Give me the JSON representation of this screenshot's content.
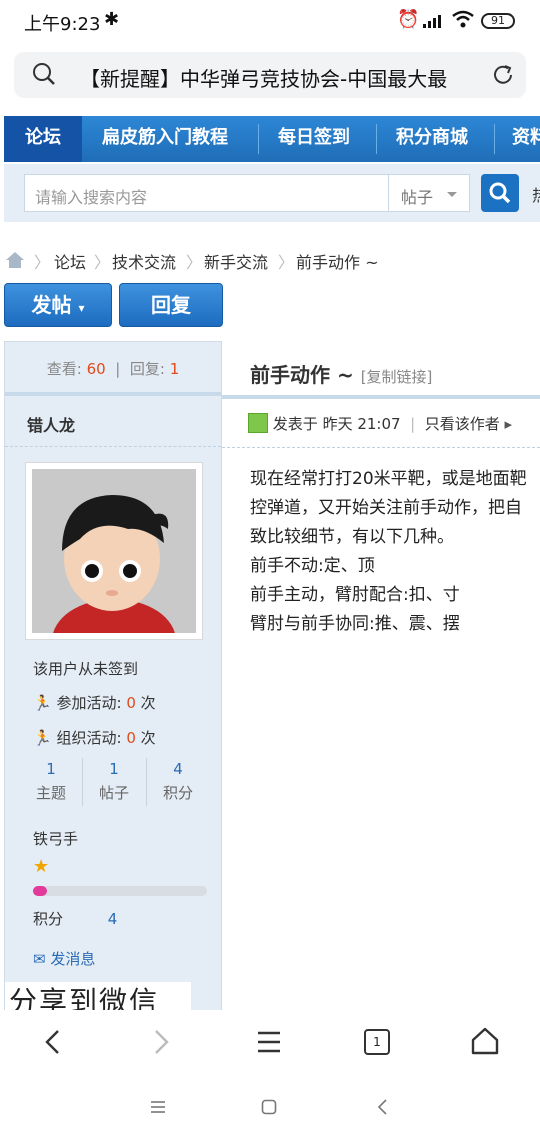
{
  "status_bar": {
    "time": "上午9:23",
    "battery": "91"
  },
  "address_bar": {
    "url_text": "【新提醒】中华弹弓竞技协会-中国最大最"
  },
  "nav": {
    "items": [
      {
        "label": "论坛",
        "active": true
      },
      {
        "label": "扁皮筋入门教程"
      },
      {
        "label": "每日签到"
      },
      {
        "label": "积分商城"
      },
      {
        "label": "资料"
      }
    ]
  },
  "search": {
    "placeholder": "请输入搜索内容",
    "scope": "帖子",
    "more": "热"
  },
  "breadcrumb": [
    "论坛",
    "技术交流",
    "新手交流",
    "前手动作 ~"
  ],
  "actions": {
    "post_label": "发帖",
    "reply_label": "回复"
  },
  "sidebar": {
    "views_label": "查看:",
    "views": "60",
    "replies_label": "回复:",
    "replies": "1",
    "username": "错人龙",
    "checkin": "该用户从未签到",
    "activity_join_label": "参加活动:",
    "activity_join_value": "0",
    "activity_org_label": "组织活动:",
    "activity_org_value": "0",
    "times_unit": "次",
    "counts": [
      {
        "value": "1",
        "label": "主题"
      },
      {
        "value": "1",
        "label": "帖子"
      },
      {
        "value": "4",
        "label": "积分"
      }
    ],
    "rank": "铁弓手",
    "progress": 0.08,
    "points_label": "积分",
    "points_value": "4",
    "message": "发消息",
    "share": "分享到微信"
  },
  "post": {
    "title": "前手动作 ~",
    "copy_link": "[复制链接]",
    "posted_label": "发表于",
    "posted_time": "昨天 21:07",
    "author_only": "只看该作者",
    "body_lines": [
      "现在经常打打20米平靶，或是地面靶",
      "控弹道，又开始关注前手动作，把自",
      "致比较细节，有以下几种。",
      "前手不动:定、顶",
      "前手主动，臂肘配合:扣、寸",
      "臂肘与前手协同:推、震、摆"
    ]
  },
  "browser_toolbar": {
    "tab_count": "1"
  }
}
